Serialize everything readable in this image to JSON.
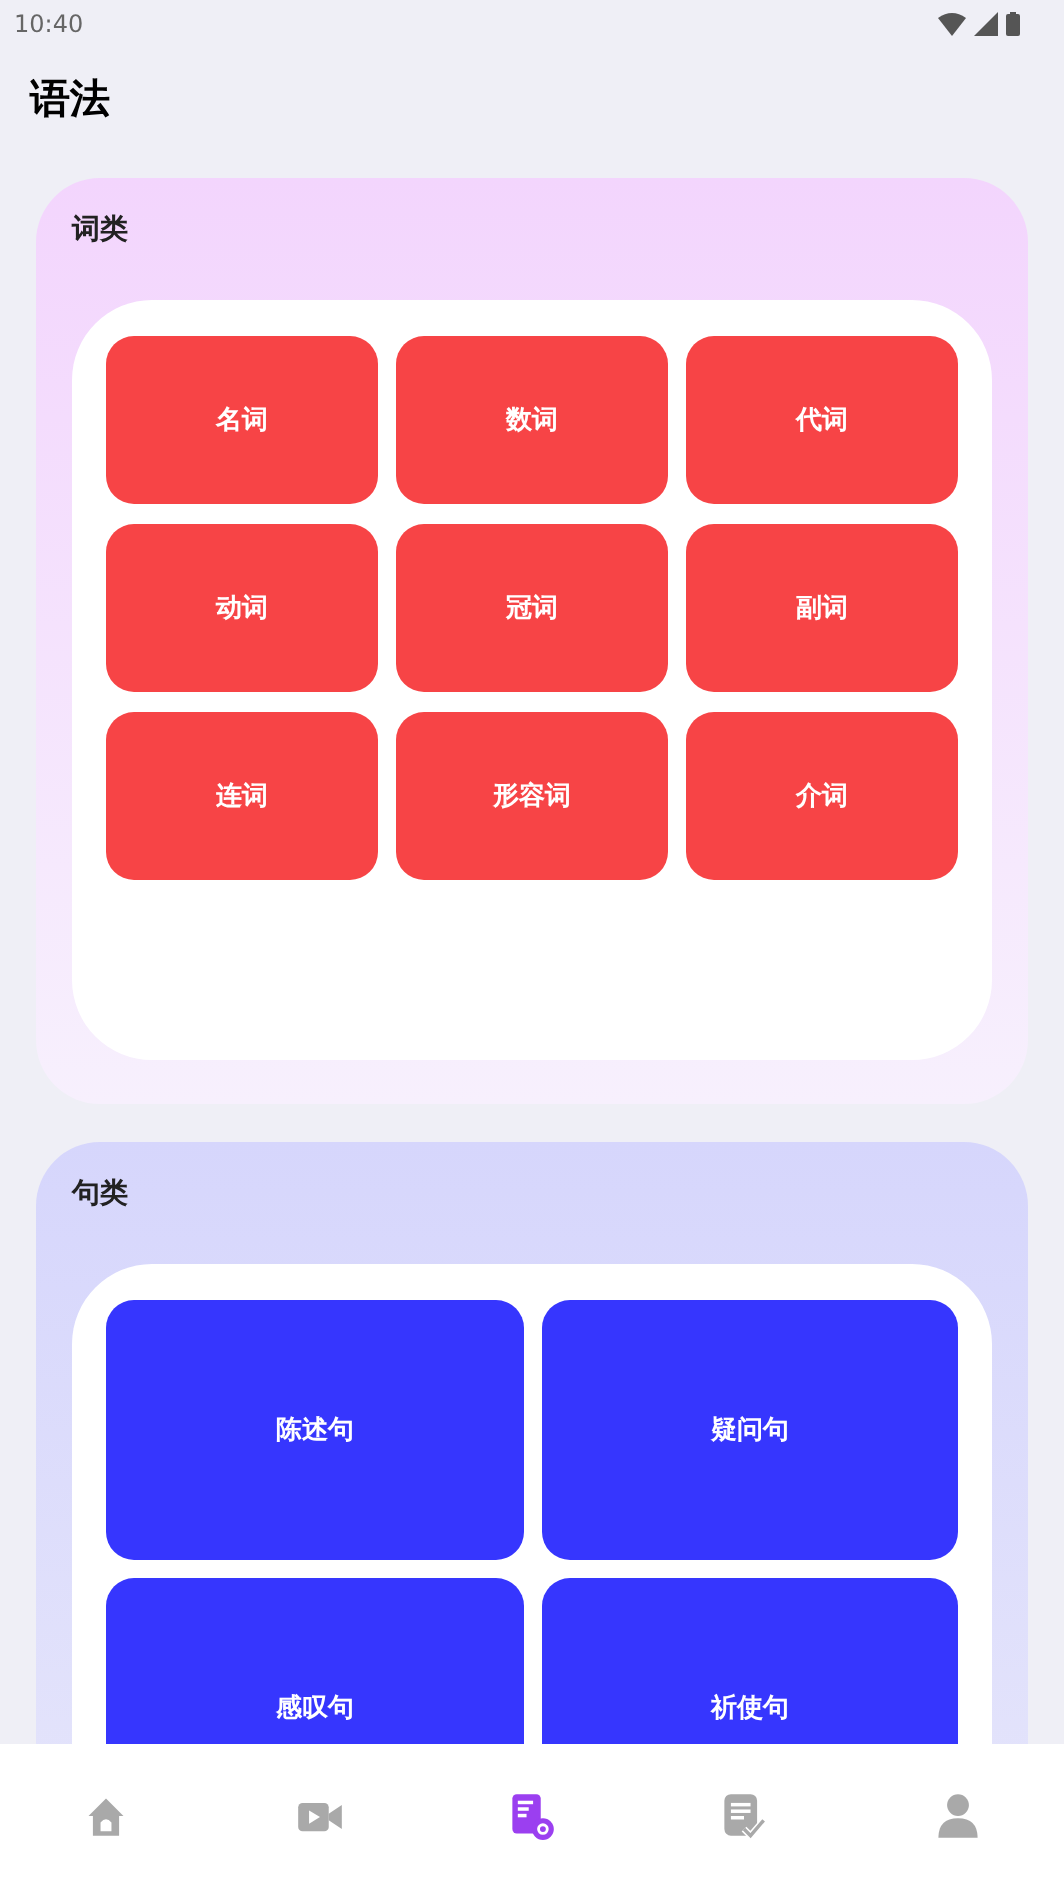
{
  "status_bar": {
    "time": "10:40"
  },
  "title": "语法",
  "sections": [
    {
      "title": "词类",
      "kind": "word",
      "items": [
        "名词",
        "数词",
        "代词",
        "动词",
        "冠词",
        "副词",
        "连词",
        "形容词",
        "介词"
      ]
    },
    {
      "title": "句类",
      "kind": "sentence",
      "items": [
        "陈述句",
        "疑问句",
        "感叹句",
        "祈使句"
      ]
    }
  ],
  "nav": [
    {
      "kind": "home",
      "selected": false
    },
    {
      "kind": "video",
      "selected": false
    },
    {
      "kind": "grammar",
      "selected": true
    },
    {
      "kind": "exercise",
      "selected": false
    },
    {
      "kind": "profile",
      "selected": false
    }
  ]
}
